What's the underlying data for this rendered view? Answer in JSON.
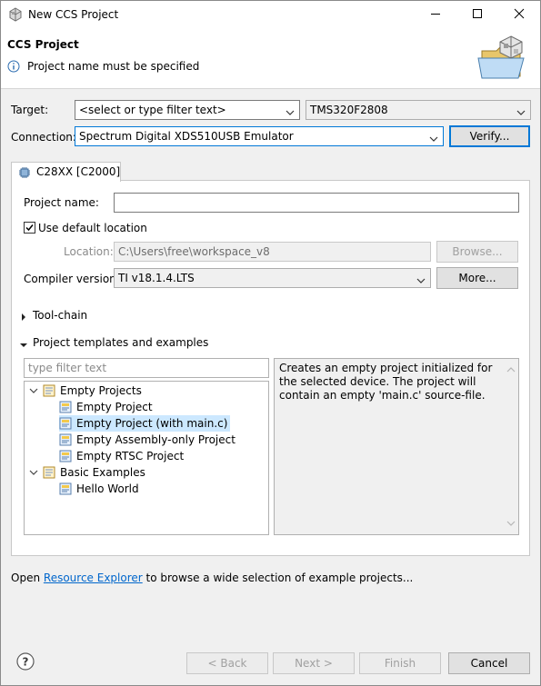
{
  "window": {
    "title": "New CCS Project",
    "minimize_icon": "minimize-icon",
    "maximize_icon": "maximize-icon",
    "close_icon": "close-icon"
  },
  "header": {
    "title": "CCS Project",
    "message": "Project name must be specified",
    "message_icon": "info-icon",
    "banner_icon": "folder-wizard-icon"
  },
  "target": {
    "label": "Target:",
    "filter_value": "<select or type filter text>",
    "device_value": "TMS320F2808"
  },
  "connection": {
    "label": "Connection:",
    "value": "Spectrum Digital XDS510USB Emulator",
    "verify_label": "Verify..."
  },
  "tab": {
    "label": "C28XX [C2000]",
    "icon": "chip-icon"
  },
  "project": {
    "name_label": "Project name:",
    "name_value": "",
    "use_default_label": "Use default location",
    "use_default_checked": true,
    "location_label": "Location:",
    "location_value": "C:\\Users\\free\\workspace_v8",
    "browse_label": "Browse...",
    "compiler_label": "Compiler version:",
    "compiler_value": "TI v18.1.4.LTS",
    "more_label": "More..."
  },
  "sections": {
    "toolchain_label": "Tool-chain",
    "templates_label": "Project templates and examples"
  },
  "templates": {
    "filter_placeholder": "type filter text",
    "tree": [
      {
        "label": "Empty Projects",
        "level": 0,
        "expanded": true,
        "icon": "template-folder-icon"
      },
      {
        "label": "Empty Project",
        "level": 1,
        "icon": "template-icon"
      },
      {
        "label": "Empty Project (with main.c)",
        "level": 1,
        "icon": "template-icon",
        "selected": true
      },
      {
        "label": "Empty Assembly-only Project",
        "level": 1,
        "icon": "template-icon"
      },
      {
        "label": "Empty RTSC Project",
        "level": 1,
        "icon": "template-icon"
      },
      {
        "label": "Basic Examples",
        "level": 0,
        "expanded": true,
        "icon": "template-folder-icon"
      },
      {
        "label": "Hello World",
        "level": 1,
        "icon": "template-icon"
      }
    ],
    "description": "Creates an empty project initialized for the selected device. The project will contain an empty 'main.c' source-file."
  },
  "footer": {
    "open_text": "Open",
    "link_text": "Resource Explorer",
    "rest_text": "to browse a wide selection of example projects..."
  },
  "buttons": {
    "help_icon": "help-icon",
    "back": "< Back",
    "next": "Next >",
    "finish": "Finish",
    "cancel": "Cancel"
  },
  "colors": {
    "selection": "#cce8ff",
    "focus": "#0078d7",
    "link": "#0066cc"
  }
}
